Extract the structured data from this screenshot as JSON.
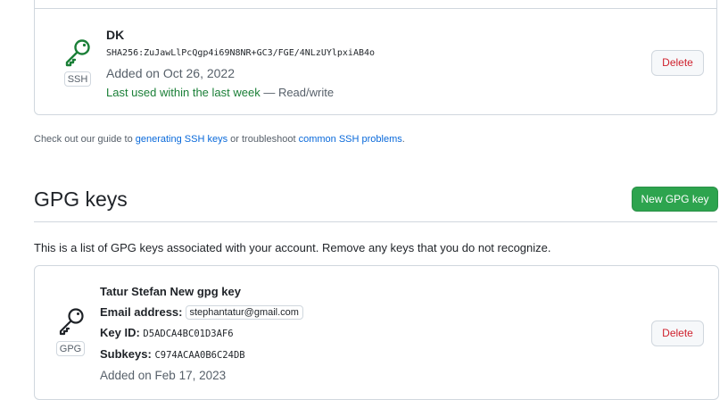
{
  "ssh_key": {
    "title": "DK",
    "fingerprint": "SHA256:ZuJawLlPcQgp4i69N8NR+GC3/FGE/4NLzUYlpxiAB4o",
    "added": "Added on Oct 26, 2022",
    "last_used": "Last used within the last week",
    "access": " — Read/write",
    "badge": "SSH",
    "delete_label": "Delete"
  },
  "guide": {
    "prefix": "Check out our guide to ",
    "link1": "generating SSH keys",
    "middle": " or troubleshoot ",
    "link2": "common SSH problems",
    "suffix": "."
  },
  "gpg": {
    "heading": "GPG keys",
    "new_button": "New GPG key",
    "description": "This is a list of GPG keys associated with your account. Remove any keys that you do not recognize.",
    "key": {
      "title": "Tatur Stefan New gpg key",
      "email_label": "Email address:",
      "email": "stephantatur@gmail.com",
      "key_id_label": "Key ID:",
      "key_id": "D5ADCA4BC01D3AF6",
      "subkeys_label": "Subkeys:",
      "subkeys": "C974ACAA0B6C24DB",
      "added": "Added on Feb 17, 2023",
      "badge": "GPG",
      "delete_label": "Delete"
    }
  },
  "colors": {
    "success_text": "#1a7f37",
    "link": "#0969da",
    "danger": "#cf222e",
    "primary_button": "#2da44e"
  },
  "icons": {
    "ssh_key": "key-icon",
    "gpg_key": "key-icon"
  }
}
